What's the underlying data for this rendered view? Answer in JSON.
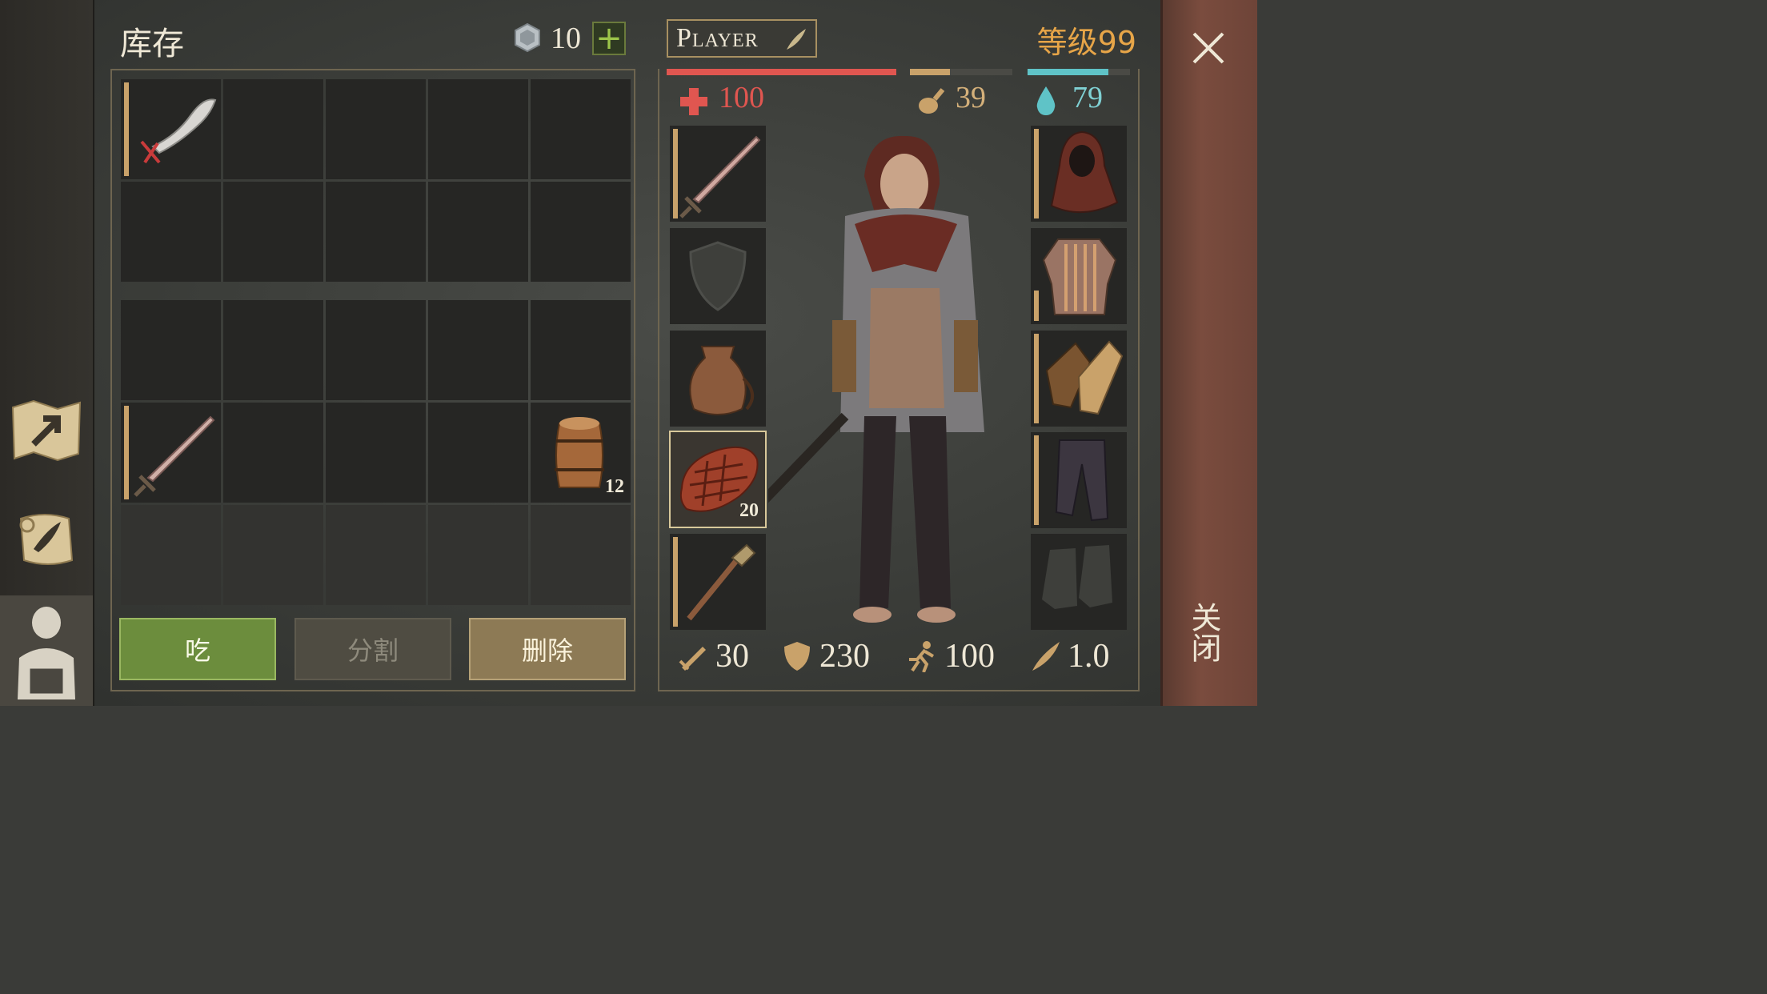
{
  "inventory": {
    "title": "库存",
    "coins": "10",
    "add_label": "+",
    "grid_top_items": [
      {
        "name": "scimitar",
        "qty": ""
      },
      {
        "name": "",
        "qty": ""
      }
    ],
    "grid_bottom_items": [
      {
        "name": "sword",
        "qty": ""
      },
      {
        "name": "barrel",
        "qty": "12"
      }
    ],
    "buttons": {
      "eat": "吃",
      "split": "分割",
      "delete": "删除"
    }
  },
  "character": {
    "name": "Player",
    "level": "等级99",
    "health": "100",
    "hunger": "39",
    "thirst": "79",
    "health_pct": 100,
    "hunger_pct": 39,
    "thirst_pct": 79,
    "equipment_left": [
      {
        "slot": "weapon",
        "qty": ""
      },
      {
        "slot": "shield",
        "qty": ""
      },
      {
        "slot": "bag",
        "qty": ""
      },
      {
        "slot": "food",
        "qty": "20"
      },
      {
        "slot": "torch",
        "qty": ""
      }
    ],
    "equipment_right": [
      {
        "slot": "hood",
        "qty": ""
      },
      {
        "slot": "chainmail",
        "qty": ""
      },
      {
        "slot": "gloves",
        "qty": ""
      },
      {
        "slot": "pants",
        "qty": ""
      },
      {
        "slot": "boots",
        "qty": ""
      }
    ],
    "attributes": {
      "attack": "30",
      "defense": "230",
      "speed": "100",
      "weight": "1.0"
    }
  },
  "close": {
    "label": "关闭"
  },
  "colors": {
    "health": "#e05650",
    "hunger": "#c9a26a",
    "thirst": "#5fc3c7",
    "level": "#e7a548",
    "eat_button": "#6c8d3d"
  }
}
